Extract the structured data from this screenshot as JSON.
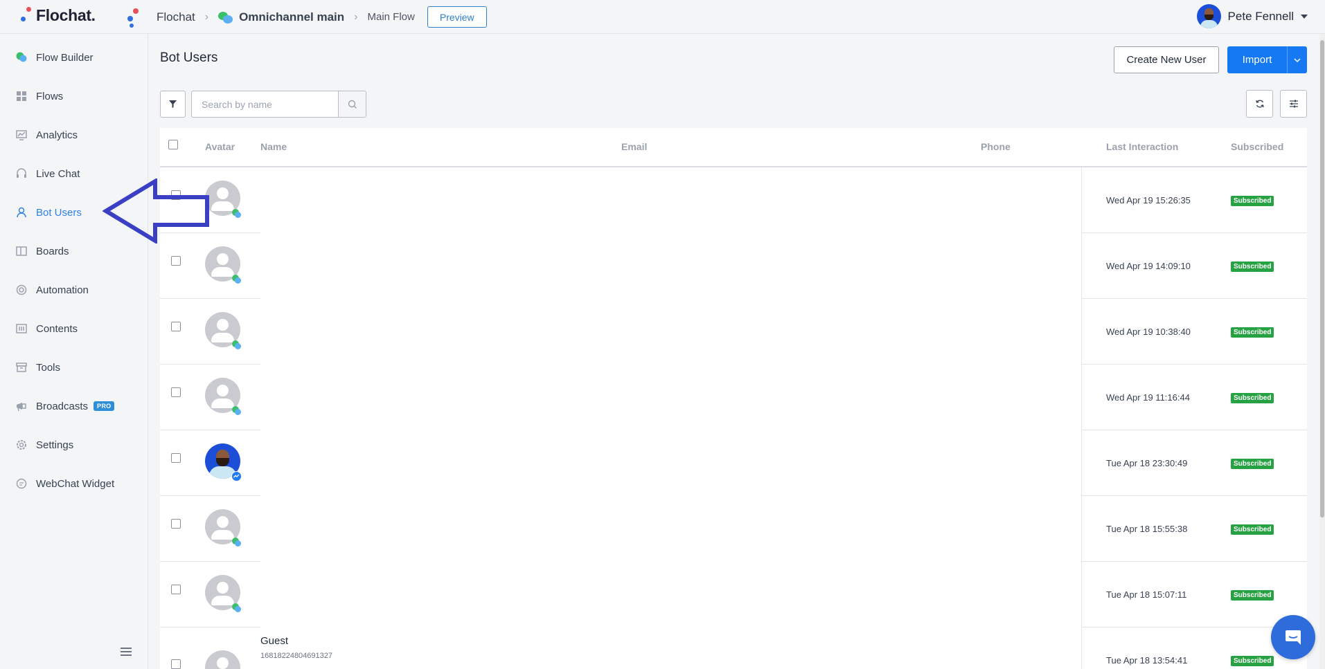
{
  "header": {
    "brand": "Flochat.",
    "workspace": "Flochat",
    "flow_group": "Omnichannel main",
    "flow": "Main Flow",
    "preview_label": "Preview",
    "user_name": "Pete Fennell"
  },
  "sidebar": {
    "items": [
      {
        "label": "Flow Builder",
        "icon": "chat-bubbles-icon"
      },
      {
        "label": "Flows",
        "icon": "grid-icon"
      },
      {
        "label": "Analytics",
        "icon": "chart-icon"
      },
      {
        "label": "Live Chat",
        "icon": "headset-icon"
      },
      {
        "label": "Bot Users",
        "icon": "user-icon",
        "active": true
      },
      {
        "label": "Boards",
        "icon": "columns-icon"
      },
      {
        "label": "Automation",
        "icon": "automation-icon"
      },
      {
        "label": "Contents",
        "icon": "contents-icon"
      },
      {
        "label": "Tools",
        "icon": "archive-icon"
      },
      {
        "label": "Broadcasts",
        "icon": "megaphone-icon",
        "badge": "PRO"
      },
      {
        "label": "Settings",
        "icon": "gear-icon"
      },
      {
        "label": "WebChat Widget",
        "icon": "message-circle-icon"
      }
    ]
  },
  "main": {
    "title": "Bot Users",
    "create_label": "Create New User",
    "import_label": "Import",
    "search_placeholder": "Search by name"
  },
  "table": {
    "columns": [
      "Avatar",
      "Name",
      "Email",
      "Phone",
      "Last Interaction",
      "Subscribed"
    ],
    "rows": [
      {
        "avatar": "placeholder",
        "channel": "webchat",
        "name": "",
        "uid": "",
        "last_interaction": "Wed Apr 19 15:26:35",
        "status": "Subscribed"
      },
      {
        "avatar": "placeholder",
        "channel": "webchat",
        "name": "",
        "uid": "",
        "last_interaction": "Wed Apr 19 14:09:10",
        "status": "Subscribed"
      },
      {
        "avatar": "placeholder",
        "channel": "webchat",
        "name": "",
        "uid": "",
        "last_interaction": "Wed Apr 19 10:38:40",
        "status": "Subscribed"
      },
      {
        "avatar": "placeholder",
        "channel": "webchat",
        "name": "",
        "uid": "",
        "last_interaction": "Wed Apr 19 11:16:44",
        "status": "Subscribed"
      },
      {
        "avatar": "photo",
        "channel": "messenger",
        "name": "",
        "uid": "",
        "last_interaction": "Tue Apr 18 23:30:49",
        "status": "Subscribed"
      },
      {
        "avatar": "placeholder",
        "channel": "webchat",
        "name": "",
        "uid": "",
        "last_interaction": "Tue Apr 18 15:55:38",
        "status": "Subscribed"
      },
      {
        "avatar": "placeholder",
        "channel": "webchat",
        "name": "",
        "uid": "",
        "last_interaction": "Tue Apr 18 15:07:11",
        "status": "Subscribed"
      },
      {
        "avatar": "placeholder",
        "channel": "webchat",
        "name": "Guest",
        "uid": "16818224804691327",
        "last_interaction": "Tue Apr 18 13:54:41",
        "status": "Subscribed"
      }
    ]
  },
  "colors": {
    "accent": "#1479f2",
    "active_nav": "#2f80e7",
    "subscribed": "#27a243",
    "annotation_arrow": "#3b3fc4"
  }
}
